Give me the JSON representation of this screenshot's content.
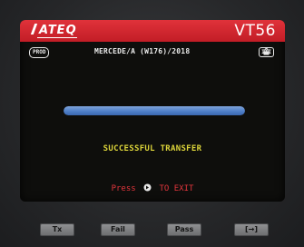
{
  "header": {
    "brand": "ATEQ",
    "model": "VT56"
  },
  "info": {
    "mode_badge": "PROD",
    "vehicle": "MERCEDE/A (W176)/2018",
    "battery_badge": "III",
    "icons": [
      "lock-icon",
      "battery-icon"
    ]
  },
  "progress": {
    "value": 1.0,
    "color": "#4f7fc9"
  },
  "status": {
    "message": "SUCCESSFUL TRANSFER",
    "message_color": "#dcd43a"
  },
  "exit": {
    "prefix": "Press",
    "suffix": "TO EXIT",
    "icon": "key-icon",
    "color": "#e2353c"
  },
  "softkeys": {
    "tx": "Tx",
    "fail": "Fail",
    "pass": "Pass",
    "back": "[→]"
  },
  "colors": {
    "title_bar": "#c21d26",
    "screen_bg": "#0e0e0c"
  }
}
